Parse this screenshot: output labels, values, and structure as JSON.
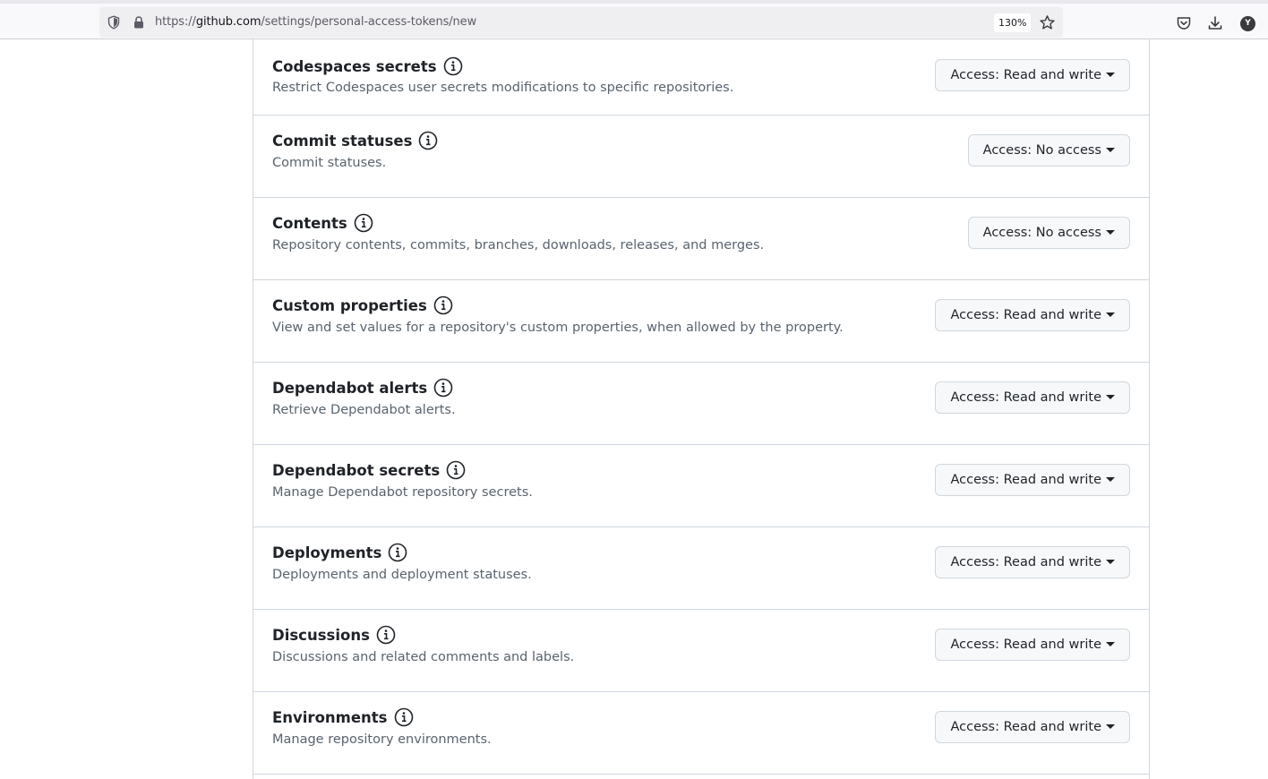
{
  "browser": {
    "url_prefix": "https://",
    "url_host": "github.com",
    "url_path": "/settings/personal-access-tokens/new",
    "zoom": "130%",
    "avatar_letter": "Y"
  },
  "permissions": [
    {
      "title": "Codespaces secrets",
      "description": "Restrict Codespaces user secrets modifications to specific repositories.",
      "access": "Access: Read and write"
    },
    {
      "title": "Commit statuses",
      "description": "Commit statuses.",
      "access": "Access: No access"
    },
    {
      "title": "Contents",
      "description": "Repository contents, commits, branches, downloads, releases, and merges.",
      "access": "Access: No access"
    },
    {
      "title": "Custom properties",
      "description": "View and set values for a repository's custom properties, when allowed by the property.",
      "access": "Access: Read and write"
    },
    {
      "title": "Dependabot alerts",
      "description": "Retrieve Dependabot alerts.",
      "access": "Access: Read and write"
    },
    {
      "title": "Dependabot secrets",
      "description": "Manage Dependabot repository secrets.",
      "access": "Access: Read and write"
    },
    {
      "title": "Deployments",
      "description": "Deployments and deployment statuses.",
      "access": "Access: Read and write"
    },
    {
      "title": "Discussions",
      "description": "Discussions and related comments and labels.",
      "access": "Access: Read and write"
    },
    {
      "title": "Environments",
      "description": "Manage repository environments.",
      "access": "Access: Read and write"
    }
  ]
}
